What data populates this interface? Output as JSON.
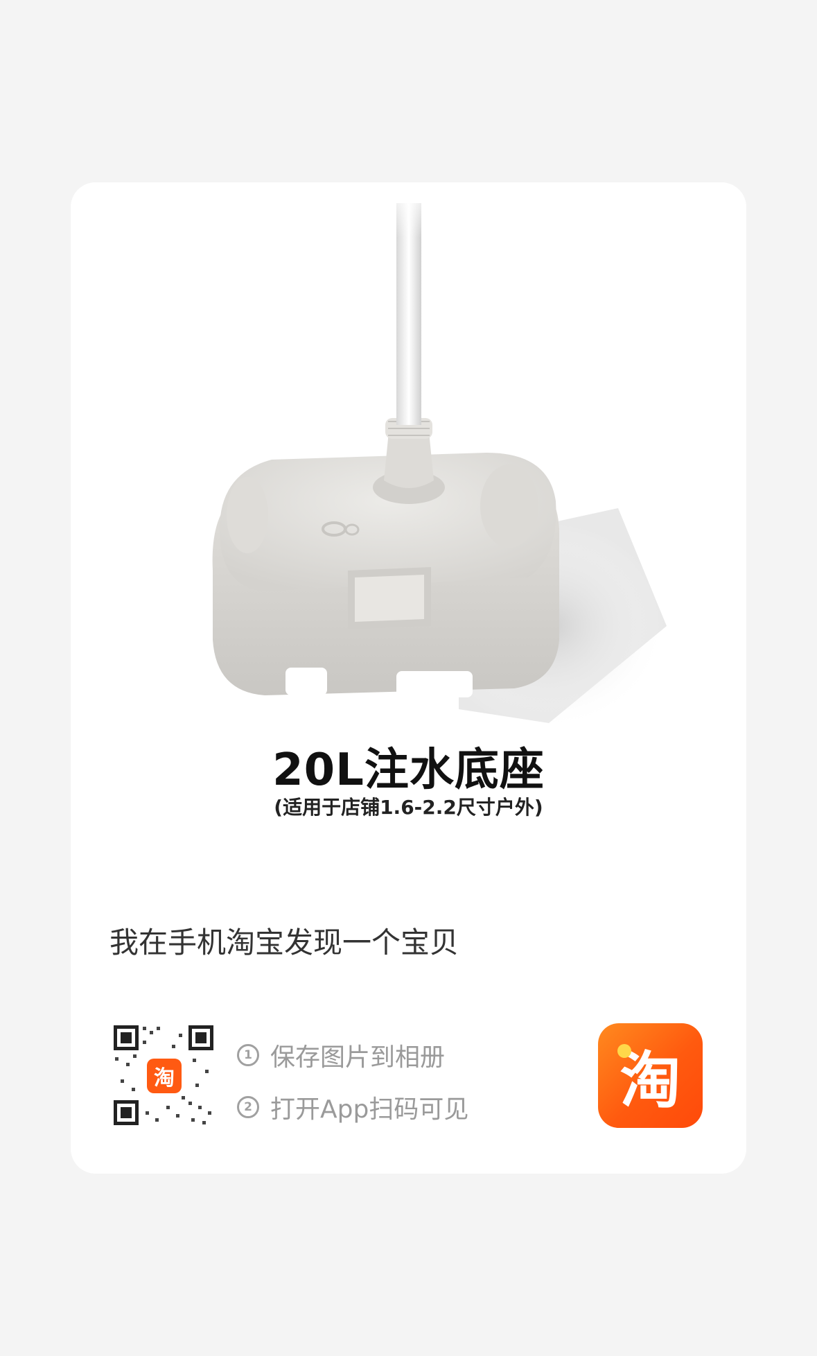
{
  "product": {
    "title": "20L注水底座",
    "subtitle": "(适用于店铺1.6-2.2尺寸户外)"
  },
  "share": {
    "message": "我在手机淘宝发现一个宝贝",
    "qr_logo_char": "淘",
    "steps": [
      {
        "num": "1",
        "text": "保存图片到相册"
      },
      {
        "num": "2",
        "text": "打开App扫码可见"
      }
    ]
  },
  "logo": {
    "char": "淘",
    "color": "#ff5a0f"
  }
}
